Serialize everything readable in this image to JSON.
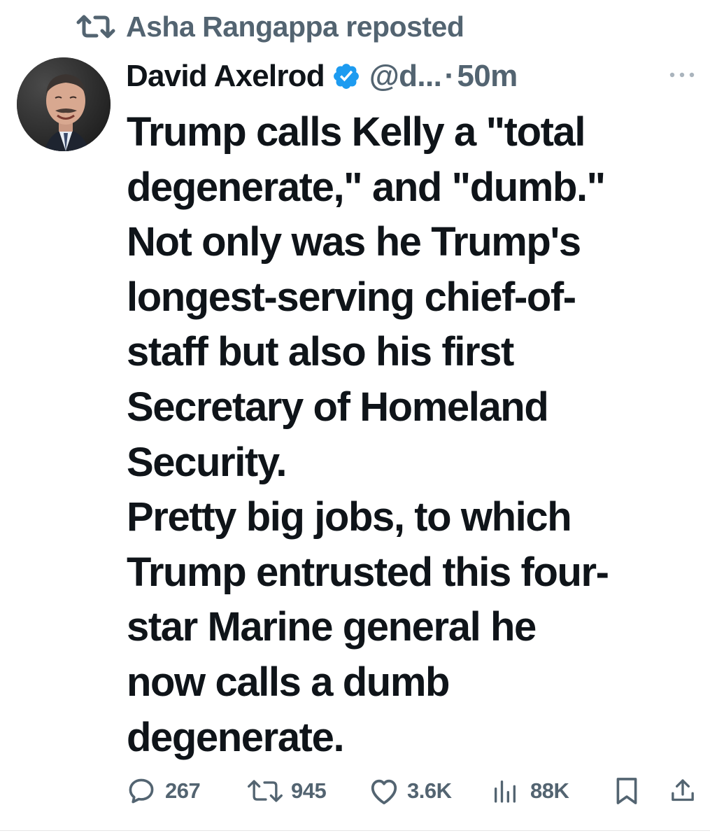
{
  "repost": {
    "icon": "repost-icon",
    "text": "Asha Rangappa reposted"
  },
  "author": {
    "avatar": "avatar",
    "name": "David Axelrod",
    "verified_icon": "verified-badge-icon",
    "handle": "@d...",
    "separator": "·",
    "time": "50m",
    "more_icon": "more-options-icon"
  },
  "tweet": {
    "lines": [
      "Trump calls Kelly a \"total",
      "degenerate,\" and \"dumb.\"",
      "Not only was he Trump's",
      "longest-serving chief-of-",
      "staff but also his first",
      "Secretary of Homeland",
      "Security.",
      "Pretty big jobs, to which",
      "Trump entrusted this four-",
      "star Marine general he",
      "now calls a dumb",
      "degenerate."
    ]
  },
  "actions": {
    "reply": {
      "icon": "reply-icon",
      "count": "267"
    },
    "retweet": {
      "icon": "retweet-icon",
      "count": "945"
    },
    "like": {
      "icon": "heart-icon",
      "count": "3.6K"
    },
    "views": {
      "icon": "views-icon",
      "count": "88K"
    },
    "bookmark": {
      "icon": "bookmark-icon"
    },
    "share": {
      "icon": "share-icon"
    }
  },
  "colors": {
    "text": "#0f1419",
    "secondary": "#536471",
    "verified": "#1d9bf0"
  }
}
